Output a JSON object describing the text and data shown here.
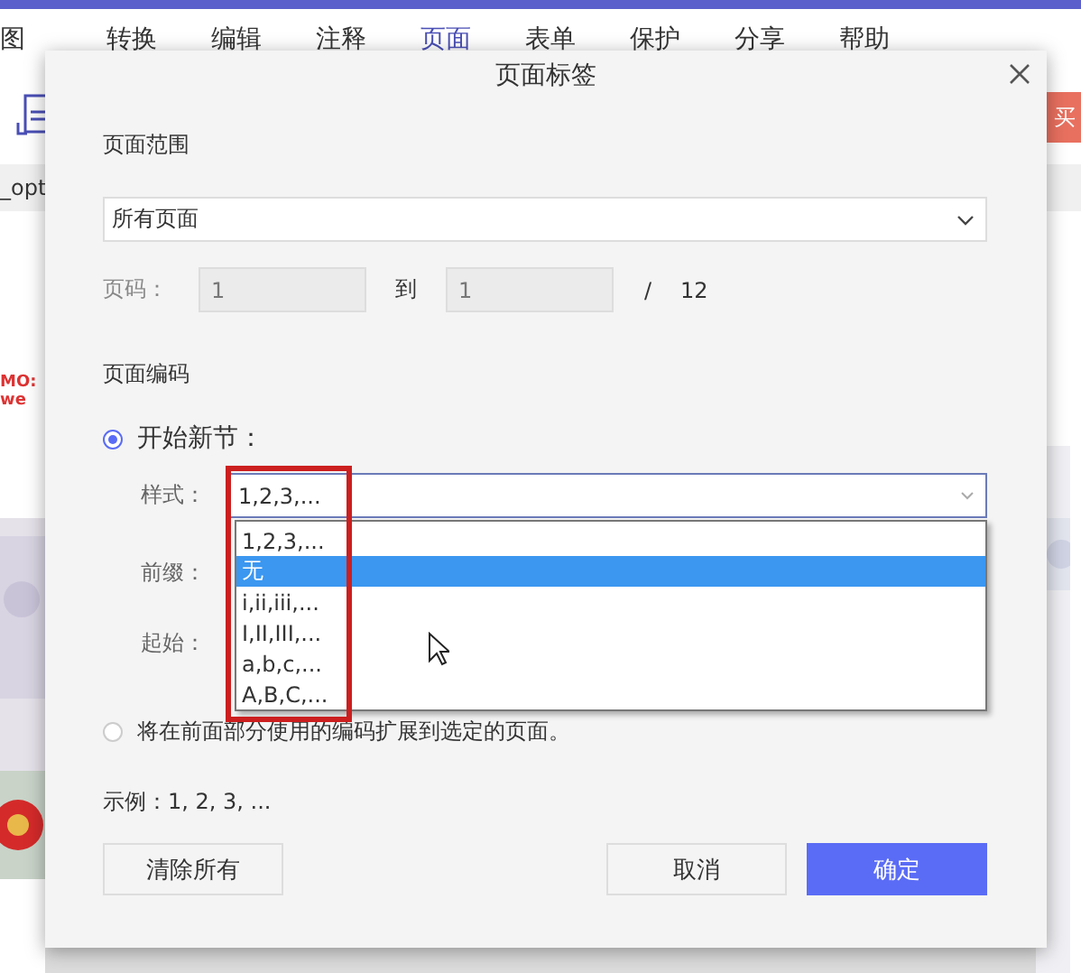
{
  "app": {
    "menu_tabs": [
      {
        "label": "图",
        "selected": false
      },
      {
        "label": "转换",
        "selected": false
      },
      {
        "label": "编辑",
        "selected": false
      },
      {
        "label": "注释",
        "selected": false
      },
      {
        "label": "页面",
        "selected": true
      },
      {
        "label": "表单",
        "selected": false
      },
      {
        "label": "保护",
        "selected": false
      },
      {
        "label": "分享",
        "selected": false
      },
      {
        "label": "帮助",
        "selected": false
      }
    ],
    "buy_button": "买",
    "doc_tab": "_opt",
    "thumbnail_lines": [
      "MO:",
      "we"
    ]
  },
  "dialog": {
    "title": "页面标签",
    "range": {
      "label": "页面范围",
      "value": "所有页面"
    },
    "pages": {
      "label": "页码：",
      "from": "1",
      "to_label": "到",
      "to": "1",
      "separator": "/",
      "total": "12"
    },
    "numbering_label": "页面编码",
    "options": [
      {
        "label": "开始新节：",
        "selected": true
      },
      {
        "label": "将在前面部分使用的编码扩展到选定的页面。",
        "selected": false
      }
    ],
    "style": {
      "label": "样式：",
      "value": "1,2,3,...",
      "expanded": true,
      "choices": [
        {
          "label": "1,2,3,...",
          "highlighted": false
        },
        {
          "label": "无",
          "highlighted": true
        },
        {
          "label": "i,ii,iii,...",
          "highlighted": false
        },
        {
          "label": "I,II,III,...",
          "highlighted": false
        },
        {
          "label": "a,b,c,...",
          "highlighted": false
        },
        {
          "label": "A,B,C,...",
          "highlighted": false
        }
      ]
    },
    "prefix_label": "前缀：",
    "start_label": "起始：",
    "example": "示例：1, 2, 3, ...",
    "buttons": [
      {
        "label": "清除所有",
        "kind": "secondary"
      },
      {
        "label": "取消",
        "kind": "secondary"
      },
      {
        "label": "确定",
        "kind": "primary"
      }
    ]
  }
}
